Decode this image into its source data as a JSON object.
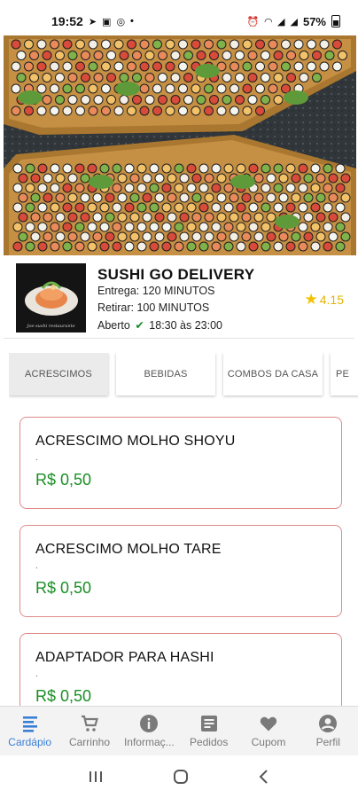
{
  "status_bar": {
    "time": "19:52",
    "left_icons": [
      "telegram-icon",
      "message-icon",
      "instagram-icon",
      "dot-icon"
    ],
    "battery": "57%",
    "right_icons": [
      "alarm-icon",
      "wifi-icon",
      "signal-icon",
      "signal-icon",
      "battery-icon"
    ]
  },
  "restaurant": {
    "name": "SUSHI GO DELIVERY",
    "delivery_text": "Entrega: 120 MINUTOS",
    "pickup_text": "Retirar: 100 MINUTOS",
    "status_label": "Aberto",
    "hours": "18:30 às 23:00",
    "rating": "4.15",
    "logo_caption": "Joe-sushi restaurante"
  },
  "categories": [
    {
      "label": "ACRESCIMOS",
      "active": true
    },
    {
      "label": "BEBIDAS",
      "active": false
    },
    {
      "label": "COMBOS DA CASA",
      "active": false
    },
    {
      "label": "PE",
      "active": false
    }
  ],
  "products": [
    {
      "name": "ACRESCIMO MOLHO SHOYU",
      "description": ".",
      "price": "R$ 0,50"
    },
    {
      "name": "ACRESCIMO MOLHO TARE",
      "description": ".",
      "price": "R$ 0,50"
    },
    {
      "name": "ADAPTADOR PARA HASHI",
      "description": ".",
      "price": "R$ 0,50"
    }
  ],
  "bottom_nav": [
    {
      "label": "Cardápio",
      "icon": "menu-list-icon",
      "active": true
    },
    {
      "label": "Carrinho",
      "icon": "cart-icon",
      "active": false
    },
    {
      "label": "Informaç...",
      "icon": "info-icon",
      "active": false
    },
    {
      "label": "Pedidos",
      "icon": "orders-icon",
      "active": false
    },
    {
      "label": "Cupom",
      "icon": "heart-icon",
      "active": false
    },
    {
      "label": "Perfil",
      "icon": "profile-icon",
      "active": false
    }
  ],
  "colors": {
    "price_green": "#1a8f24",
    "nav_active": "#3a7fd6",
    "card_border": "#e08a8a",
    "rating_star": "#f2c200"
  }
}
